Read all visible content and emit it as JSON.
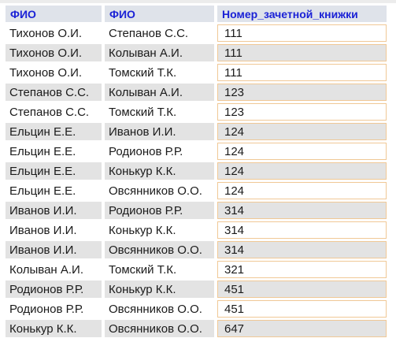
{
  "table": {
    "headers": [
      "ФИО",
      "ФИО",
      "Номер_зачетной_книжки"
    ],
    "rows": [
      [
        "Тихонов О.И.",
        "Степанов С.С.",
        "111"
      ],
      [
        "Тихонов О.И.",
        "Колыван А.И.",
        "111"
      ],
      [
        "Тихонов О.И.",
        "Томский Т.К.",
        "111"
      ],
      [
        "Степанов С.С.",
        "Колыван А.И.",
        "123"
      ],
      [
        "Степанов С.С.",
        "Томский Т.К.",
        "123"
      ],
      [
        "Ельцин Е.Е.",
        "Иванов И.И.",
        "124"
      ],
      [
        "Ельцин Е.Е.",
        "Родионов Р.Р.",
        "124"
      ],
      [
        "Ельцин Е.Е.",
        "Конькур К.К.",
        "124"
      ],
      [
        "Ельцин Е.Е.",
        "Овсянников О.О.",
        "124"
      ],
      [
        "Иванов И.И.",
        "Родионов Р.Р.",
        "314"
      ],
      [
        "Иванов И.И.",
        "Конькур К.К.",
        "314"
      ],
      [
        "Иванов И.И.",
        "Овсянников О.О.",
        "314"
      ],
      [
        "Колыван А.И.",
        "Томский Т.К.",
        "321"
      ],
      [
        "Родионов Р.Р.",
        "Конькур К.К.",
        "451"
      ],
      [
        "Родионов Р.Р.",
        "Овсянников О.О.",
        "451"
      ],
      [
        "Конькур К.К.",
        "Овсянников О.О.",
        "647"
      ]
    ]
  },
  "colors": {
    "header_text": "#1b22d6",
    "header_bg": "#dfe3ea",
    "row_alt_bg": "#e3e3e3",
    "highlight_border": "#f0c896"
  }
}
